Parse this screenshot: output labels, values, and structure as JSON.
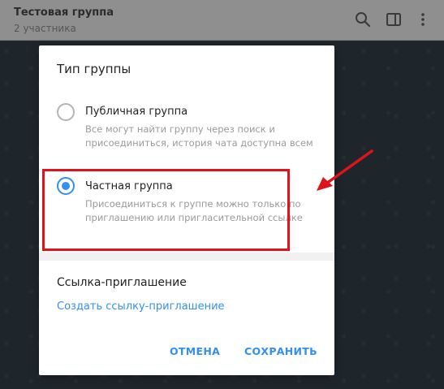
{
  "header": {
    "title": "Тестовая группа",
    "subtitle": "2 участника",
    "icons": [
      "search-icon",
      "sidebar-toggle-icon",
      "more-vertical-icon"
    ]
  },
  "dialog": {
    "title": "Тип группы",
    "options": [
      {
        "label": "Публичная группа",
        "description": "Все могут найти группу через поиск и присоединиться, история чата доступна всем",
        "selected": false
      },
      {
        "label": "Частная группа",
        "description": "Присоединиться к группе можно только по приглашению или пригласительной ссылке",
        "selected": true
      }
    ],
    "invite_section_title": "Ссылка-приглашение",
    "invite_link_text": "Создать ссылку-приглашение",
    "cancel_label": "ОТМЕНА",
    "save_label": "СОХРАНИТЬ"
  },
  "colors": {
    "accent": "#3390ec",
    "annotation": "#e0121a"
  }
}
